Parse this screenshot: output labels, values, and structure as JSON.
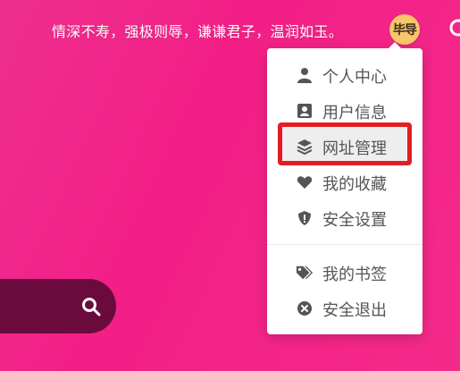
{
  "header": {
    "motto": "情深不寿，强极则辱，谦谦君子，温润如玉。",
    "avatar_text": "毕导"
  },
  "user_menu": {
    "items": [
      {
        "label": "个人中心",
        "icon": "user-icon"
      },
      {
        "label": "用户信息",
        "icon": "id-card-icon"
      },
      {
        "label": "网址管理",
        "icon": "layers-icon"
      },
      {
        "label": "我的收藏",
        "icon": "heart-icon"
      },
      {
        "label": "安全设置",
        "icon": "shield-icon"
      },
      {
        "label": "我的书签",
        "icon": "tags-icon"
      },
      {
        "label": "安全退出",
        "icon": "close-circle-icon"
      }
    ],
    "highlighted_item": "网址管理"
  },
  "colors": {
    "background": "#f21f86",
    "search_pill": "#6b0b3d",
    "highlight_border": "#e21d24",
    "menu_text": "#555555"
  }
}
